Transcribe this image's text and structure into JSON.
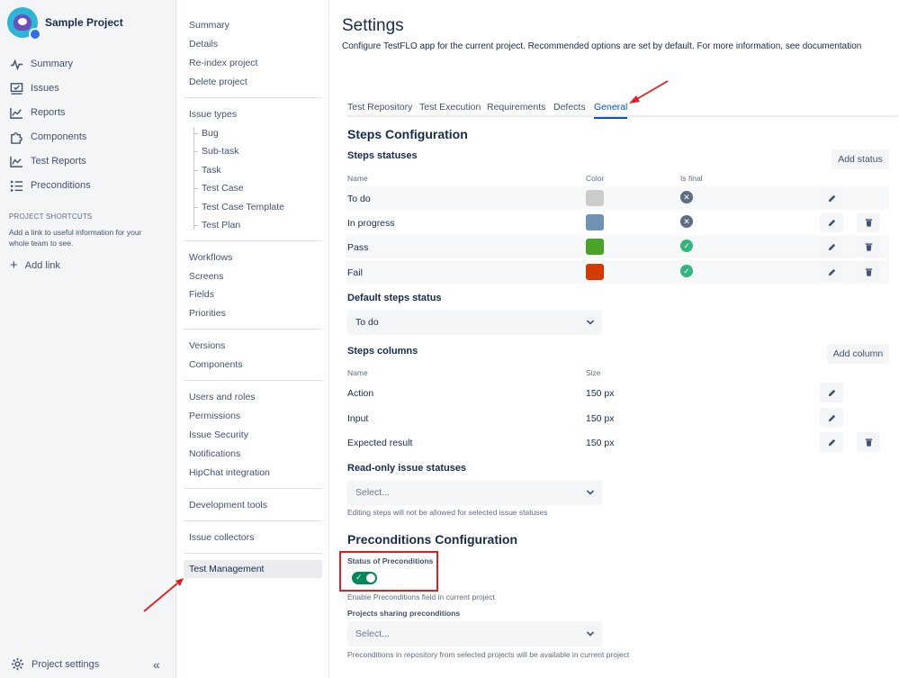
{
  "project": {
    "name": "Sample Project"
  },
  "sidebar": {
    "items": [
      {
        "label": "Summary",
        "icon": "activity-icon"
      },
      {
        "label": "Issues",
        "icon": "issues-icon"
      },
      {
        "label": "Reports",
        "icon": "reports-icon"
      },
      {
        "label": "Components",
        "icon": "puzzle-icon"
      },
      {
        "label": "Test Reports",
        "icon": "chart-icon"
      },
      {
        "label": "Preconditions",
        "icon": "list-icon"
      }
    ],
    "shortcuts_title": "PROJECT SHORTCUTS",
    "shortcuts_desc": "Add a link to useful information for your whole team to see.",
    "add_link": "Add link",
    "project_settings": "Project settings",
    "collapse": "«"
  },
  "settings_nav": {
    "group1": [
      "Summary",
      "Details",
      "Re-index project",
      "Delete project"
    ],
    "issue_types_label": "Issue types",
    "issue_types": [
      "Bug",
      "Sub-task",
      "Task",
      "Test Case",
      "Test Case Template",
      "Test Plan"
    ],
    "group3": [
      "Workflows",
      "Screens",
      "Fields",
      "Priorities"
    ],
    "group4": [
      "Versions",
      "Components"
    ],
    "group5": [
      "Users and roles",
      "Permissions",
      "Issue Security",
      "Notifications",
      "HipChat integration"
    ],
    "group6": [
      "Development tools"
    ],
    "group7": [
      "Issue collectors"
    ],
    "selected": "Test Management"
  },
  "main": {
    "title": "Settings",
    "description": "Configure TestFLO app for the current project. Recommended options are set by default. For more information, see documentation",
    "tabs": [
      {
        "label": "Test Repository",
        "active": false
      },
      {
        "label": "Test Execution",
        "active": false
      },
      {
        "label": "Requirements",
        "active": false
      },
      {
        "label": "Defects",
        "active": false
      },
      {
        "label": "General",
        "active": true
      }
    ],
    "steps_config_title": "Steps Configuration",
    "steps_statuses": {
      "title": "Steps statuses",
      "add_button": "Add status",
      "col_name": "Name",
      "col_color": "Color",
      "col_final": "Is final",
      "rows": [
        {
          "name": "To do",
          "color": "#cccccc",
          "final": false
        },
        {
          "name": "In progress",
          "color": "#6f93b3",
          "final": false
        },
        {
          "name": "Pass",
          "color": "#4aa329",
          "final": true
        },
        {
          "name": "Fail",
          "color": "#d43a00",
          "final": true
        }
      ]
    },
    "default_status": {
      "title": "Default steps status",
      "value": "To do"
    },
    "steps_columns": {
      "title": "Steps columns",
      "add_button": "Add column",
      "col_name": "Name",
      "col_size": "Size",
      "rows": [
        {
          "name": "Action",
          "size": "150 px"
        },
        {
          "name": "Input",
          "size": "150 px"
        },
        {
          "name": "Expected result",
          "size": "150 px"
        }
      ]
    },
    "readonly": {
      "title": "Read-only issue statuses",
      "placeholder": "Select...",
      "help": "Editing steps will not be allowed for selected issue statuses"
    },
    "preconditions_title": "Preconditions Configuration",
    "preconditions": {
      "status_label": "Status of Preconditions",
      "toggle_on": true,
      "status_help": "Enable Preconditions field in current project",
      "sharing_label": "Projects sharing preconditions",
      "sharing_placeholder": "Select...",
      "sharing_help": "Preconditions in repository from selected projects will be available in current project"
    }
  },
  "colors": {
    "accent": "#0052cc",
    "annotation": "#e02020",
    "success": "#36b37e",
    "neutral_status": "#5e6c84"
  }
}
